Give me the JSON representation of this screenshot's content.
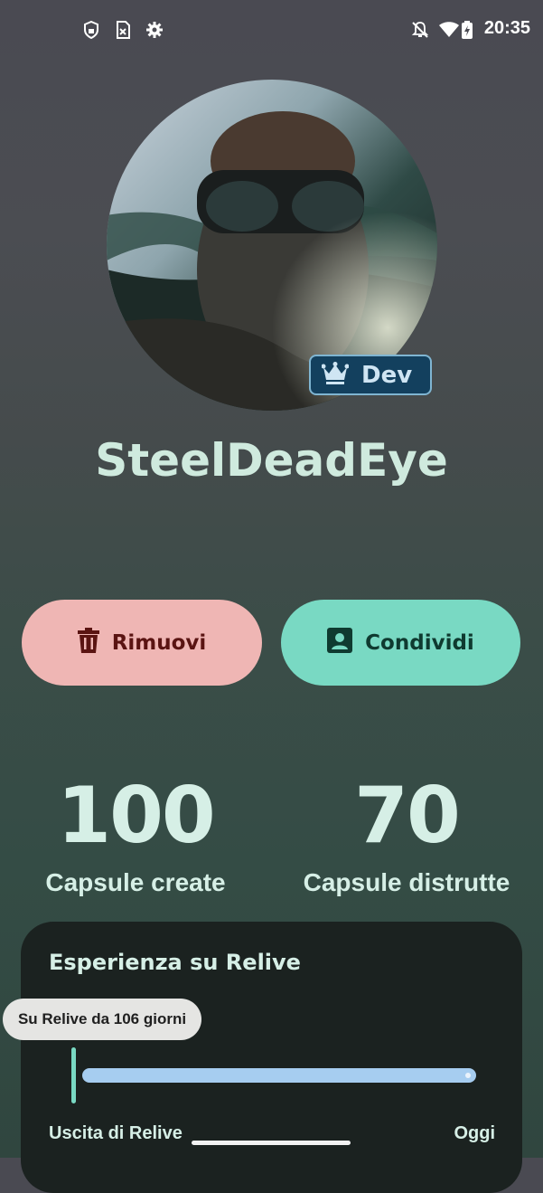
{
  "status_bar": {
    "time": "20:35",
    "left_icons": [
      "shield-lock-icon",
      "sim-off-icon",
      "settings-gear-icon"
    ],
    "right_icons": [
      "notifications-off-icon",
      "wifi-icon",
      "battery-charging-icon"
    ]
  },
  "profile": {
    "avatar_icon": "profile-photo",
    "badge": {
      "icon": "crown-icon",
      "label": "Dev"
    },
    "username": "SteelDeadEye"
  },
  "actions": {
    "remove": {
      "icon": "trash-icon",
      "label": "Rimuovi"
    },
    "share": {
      "icon": "contact-card-icon",
      "label": "Condividi"
    }
  },
  "stats": {
    "created": {
      "value": "100",
      "label": "Capsule create"
    },
    "destroyed": {
      "value": "70",
      "label": "Capsule distrutte"
    }
  },
  "experience": {
    "title": "Esperienza su Relive",
    "tooltip": "Su Relive da 106 giorni",
    "start_label": "Uscita di Relive",
    "end_label": "Oggi"
  },
  "colors": {
    "remove_button": "#efb6b4",
    "share_button": "#79d9c3",
    "track": "#a6cdf0",
    "card": "#1b2220",
    "badge": "#13405e"
  }
}
